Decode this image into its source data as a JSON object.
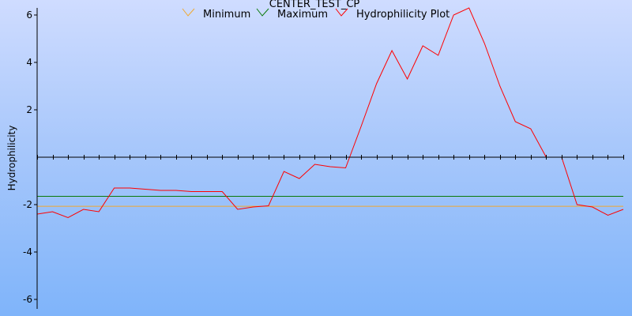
{
  "chart_data": {
    "type": "line",
    "title": "CENTER_TEST_CP",
    "ylabel": "Hydrophilicity",
    "xlabel": "",
    "ylim": [
      -6.4,
      6.3
    ],
    "xlim": [
      0,
      38
    ],
    "yticks": [
      {
        "value": 6,
        "label": "6"
      },
      {
        "value": 4,
        "label": "4"
      },
      {
        "value": 2,
        "label": "2"
      },
      {
        "value": -2,
        "label": "-2"
      },
      {
        "value": -4,
        "label": "-4"
      },
      {
        "value": -6,
        "label": "-6"
      }
    ],
    "x_tick_count": 39,
    "legend_position": "top-center",
    "series": [
      {
        "name": "Minimum",
        "color": "#f0a830",
        "kind": "hline",
        "value": -2.07
      },
      {
        "name": "Maximum",
        "color": "#0a7a0a",
        "kind": "hline",
        "value": -1.65
      },
      {
        "name": "Hydrophilicity Plot",
        "color": "#ff0000",
        "kind": "line",
        "x": [
          0,
          1,
          2,
          3,
          4,
          5,
          6,
          7,
          8,
          9,
          10,
          11,
          12,
          13,
          14,
          15,
          16,
          17,
          18,
          19,
          20,
          21,
          22,
          23,
          24,
          25,
          26,
          27,
          28,
          29,
          30,
          31,
          32,
          33,
          34,
          35,
          36,
          37,
          38
        ],
        "y": [
          -2.4,
          -2.3,
          -2.55,
          -2.2,
          -2.3,
          -1.3,
          -1.3,
          -1.35,
          -1.4,
          -1.4,
          -1.45,
          -1.45,
          -1.45,
          -2.2,
          -2.1,
          -2.05,
          -0.6,
          -0.9,
          -0.3,
          -0.4,
          -0.45,
          1.3,
          3.1,
          4.5,
          3.3,
          4.7,
          4.3,
          6.0,
          6.3,
          4.8,
          3.0,
          1.5,
          1.2,
          0.0,
          0.0,
          -2.0,
          -2.1,
          -2.45,
          -2.2
        ]
      }
    ]
  }
}
